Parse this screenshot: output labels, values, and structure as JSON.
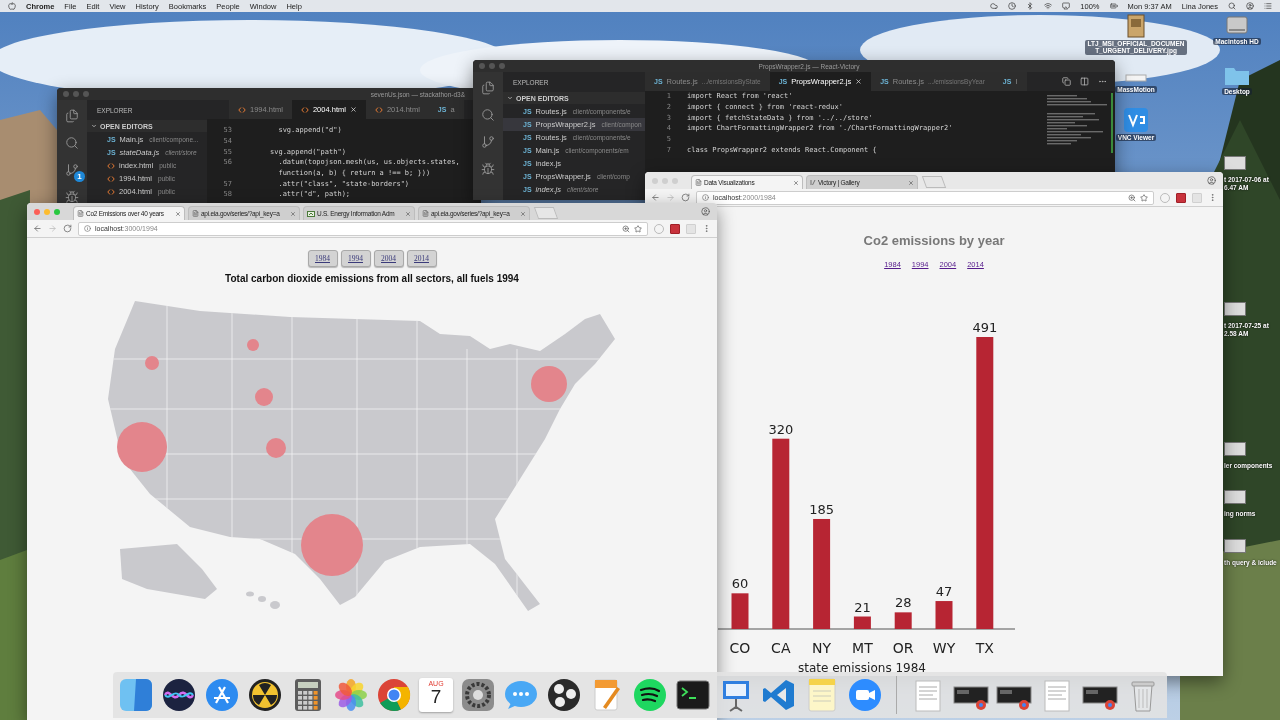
{
  "menu_bar": {
    "app_name": "Chrome",
    "menus": [
      "File",
      "Edit",
      "View",
      "History",
      "Bookmarks",
      "People",
      "Window",
      "Help"
    ],
    "battery": "100%",
    "clock": "Mon 9:37 AM",
    "user": "Lina Jones"
  },
  "desktop_icons": [
    {
      "kind": "image",
      "lines": [
        "LTJ_MSI_OFFICIAL_DOCUMEN",
        "T_URGENT_DELIVERY.jpg"
      ]
    },
    {
      "kind": "disk",
      "lines": [
        "Macintosh HD"
      ]
    },
    {
      "kind": "app",
      "lines": [
        "MassMotion"
      ]
    },
    {
      "kind": "folder",
      "lines": [
        "Desktop"
      ]
    },
    {
      "kind": "vnc",
      "lines": [
        "VNC Viewer"
      ]
    }
  ],
  "desktop_files": [
    {
      "lines": [
        "t 2017-07-06 at",
        "6.47 AM"
      ]
    },
    {
      "lines": [
        "t 2017-07-25 at",
        "2.58 AM"
      ]
    },
    {
      "lines": [
        "ler components"
      ]
    },
    {
      "lines": [
        "ing norms"
      ]
    },
    {
      "lines": [
        "th query & iclude"
      ]
    }
  ],
  "editors": [
    {
      "focused": false,
      "title": "sevenUs.json — stackathon-d3&",
      "explorer_title": "EXPLORER",
      "section": "OPEN EDITORS",
      "git_badge": "1",
      "files": [
        {
          "kind": "js",
          "icon_text": "JS",
          "name": "Main.js",
          "path": "client/compone...",
          "selected": false,
          "preview": false
        },
        {
          "kind": "js",
          "icon_text": "JS",
          "name": "stateData.js",
          "path": "client/store",
          "selected": false,
          "preview": true
        },
        {
          "kind": "html",
          "name": "index.html",
          "path": "public",
          "selected": false,
          "preview": false
        },
        {
          "kind": "html",
          "name": "1994.html",
          "path": "public",
          "selected": false,
          "preview": false
        },
        {
          "kind": "html",
          "name": "2004.html",
          "path": "public",
          "selected": false,
          "preview": false
        }
      ],
      "tabs": [
        {
          "kind": "html",
          "name": "1994.html",
          "selected": false
        },
        {
          "kind": "html",
          "name": "2004.html",
          "selected": true
        },
        {
          "kind": "html",
          "name": "2014.html",
          "selected": false
        },
        {
          "kind": "js",
          "icon_text": "JS",
          "name": "a",
          "selected": false
        }
      ],
      "lines": [
        {
          "number": "53",
          "text": "  svg.append(\"d\")"
        },
        {
          "number": "54"
        },
        {
          "number": "55",
          "text": "svg.append(\"path\")"
        },
        {
          "number": "56",
          "text": "  .datum(topojson.mesh(us, us.objects.states,"
        },
        {
          "text": "  function(a, b) { return a !== b; }))"
        },
        {
          "number": "57",
          "text": "  .attr(\"class\", \"state-borders\")"
        },
        {
          "number": "58",
          "text": "  .attr(\"d\", path);"
        }
      ]
    },
    {
      "focused": false,
      "title": "PropsWrapper2.js — React-Victory",
      "explorer_title": "EXPLORER",
      "section": "OPEN EDITORS",
      "files": [
        {
          "kind": "js",
          "icon_text": "JS",
          "name": "Routes.js",
          "path": "client/components/e",
          "selected": false,
          "preview": false
        },
        {
          "kind": "js",
          "icon_text": "JS",
          "name": "PropsWrapper2.js",
          "path": "client/compon",
          "selected": true,
          "preview": false
        },
        {
          "kind": "js",
          "icon_text": "JS",
          "name": "Routes.js",
          "path": "client/components/e",
          "selected": false,
          "preview": false
        },
        {
          "kind": "js",
          "icon_text": "JS",
          "name": "Main.js",
          "path": "client/components/em",
          "selected": false,
          "preview": false
        },
        {
          "kind": "js",
          "icon_text": "JS",
          "name": "index.js",
          "selected": false,
          "preview": false
        },
        {
          "kind": "js",
          "icon_text": "JS",
          "name": "PropsWrapper.js",
          "path": "client/comp",
          "selected": false,
          "preview": false
        },
        {
          "kind": "js",
          "icon_text": "JS",
          "name": "index.js",
          "path": "client/store",
          "selected": false,
          "preview": true
        }
      ],
      "tabs": [
        {
          "kind": "js",
          "icon_text": "JS",
          "name": "Routes.js",
          "path": ".../emissionsByState",
          "selected": false
        },
        {
          "kind": "js",
          "icon_text": "JS",
          "name": "PropsWrapper2.js",
          "selected": true
        },
        {
          "kind": "js",
          "icon_text": "JS",
          "name": "Routes.js",
          "path": ".../emissionsByYear",
          "selected": false
        },
        {
          "kind": "js",
          "icon_text": "JS",
          "name": "I",
          "selected": false
        }
      ],
      "lines": [
        {
          "number": "1",
          "text": "import React from 'react'"
        },
        {
          "number": "2",
          "text": "import { connect } from 'react-redux'"
        },
        {
          "number": "3",
          "text": "import { fetchStateData } from '../../store'"
        },
        {
          "number": "4",
          "text": "import ChartFormattingWrapper2 from './ChartFormattingWrapper2'"
        },
        {
          "number": "5"
        },
        {
          "number": "7",
          "text": "class PropsWrapper2 extends React.Component {"
        }
      ]
    }
  ],
  "browsers": [
    {
      "focused": true,
      "tabs": [
        {
          "title": "Co2 Emissions over 40 years",
          "selected": true
        },
        {
          "title": "api.eia.gov/series/?api_key=a",
          "selected": false
        },
        {
          "title": "U.S. Energy Information Adm",
          "selected": false
        },
        {
          "title": "api.eia.gov/series/?api_key=a",
          "selected": false
        }
      ],
      "url_host": "localhost",
      "url_rest": ":3000/1994",
      "year_buttons": [
        "1984",
        "1994",
        "2004",
        "2014"
      ],
      "title": "Total carbon dioxide emissions from all sectors, all fuels 1994"
    },
    {
      "focused": false,
      "tabs": [
        {
          "title": "Data Visualizations",
          "selected": true
        },
        {
          "title": "Victory | Gallery",
          "selected": false
        }
      ],
      "url_host": "localhost",
      "url_rest": ":2000/1984",
      "title": "Co2 emissions by year",
      "year_links": [
        "1984",
        "1994",
        "2004",
        "2014"
      ],
      "chart_data": {
        "type": "bar",
        "xlabel": "state emissions 1984",
        "categories": [
          "CO",
          "CA",
          "NY",
          "MT",
          "OR",
          "WY",
          "TX"
        ],
        "values": [
          60,
          320,
          185,
          21,
          28,
          47,
          491
        ],
        "data_labels": true
      }
    }
  ],
  "dock": {
    "apps": [
      {
        "kind": "finder"
      },
      {
        "kind": "siri"
      },
      {
        "kind": "appstore"
      },
      {
        "kind": "radiation"
      },
      {
        "kind": "calculator"
      },
      {
        "kind": "photos"
      },
      {
        "kind": "chrome"
      },
      {
        "kind": "calendar",
        "month": "AUG",
        "day": "7"
      },
      {
        "kind": "settings"
      },
      {
        "kind": "messages"
      },
      {
        "kind": "obs"
      },
      {
        "kind": "pages"
      },
      {
        "kind": "spotify"
      },
      {
        "kind": "terminal"
      },
      {
        "kind": "keynote"
      },
      {
        "kind": "vscode"
      },
      {
        "kind": "notes"
      },
      {
        "kind": "zoom"
      }
    ],
    "windows": [
      {
        "kind": "document"
      },
      {
        "kind": "screen"
      },
      {
        "kind": "screen"
      },
      {
        "kind": "document"
      },
      {
        "kind": "screen"
      }
    ],
    "trash": {
      "kind": "trash"
    }
  }
}
